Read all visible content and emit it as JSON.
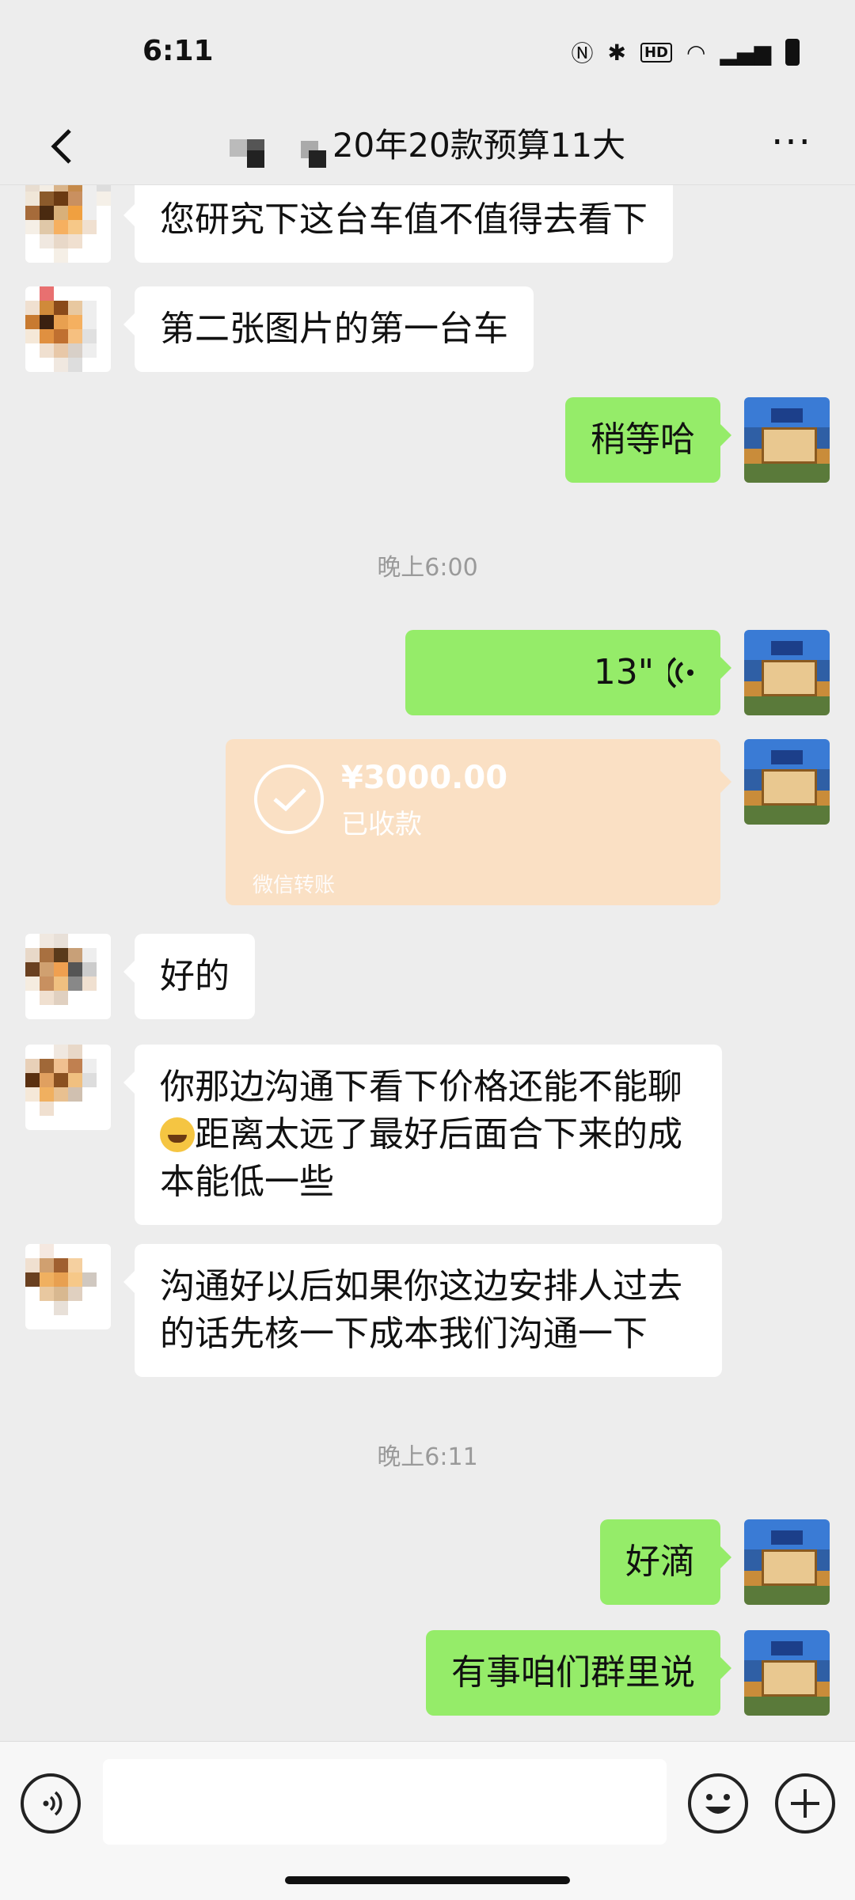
{
  "status": {
    "time": "6:11",
    "icons": [
      "nfc-icon",
      "bluetooth-icon",
      "hd-icon",
      "wifi-icon",
      "signal-5g-icon",
      "battery-icon"
    ]
  },
  "header": {
    "title": "20年20款预算11大"
  },
  "messages": [
    {
      "side": "in",
      "text": "您研究下这台车值不值得去看下"
    },
    {
      "side": "in",
      "text": "第二张图片的第一台车"
    },
    {
      "side": "out",
      "text": "稍等哈"
    },
    {
      "timestamp": "晚上6:00"
    },
    {
      "side": "out",
      "type": "voice",
      "duration": "13\""
    },
    {
      "side": "out",
      "type": "transfer",
      "amount": "¥3000.00",
      "status": "已收款",
      "footer": "微信转账"
    },
    {
      "side": "in",
      "text": "好的"
    },
    {
      "side": "in",
      "text_before_emoji": "你那边沟通下看下价格还能不能聊",
      "text_after_emoji": "距离太远了最好后面合下来的成本能低一些"
    },
    {
      "side": "in",
      "text": "沟通好以后如果你这边安排人过去的话先核一下成本我们沟通一下"
    },
    {
      "timestamp": "晚上6:11"
    },
    {
      "side": "out",
      "text": "好滴"
    },
    {
      "side": "out",
      "text": "有事咱们群里说"
    }
  ],
  "colors": {
    "outgoing_bubble": "#95ec69",
    "incoming_bubble": "#ffffff",
    "transfer_bubble": "#fae0c4",
    "background": "#ededed"
  }
}
